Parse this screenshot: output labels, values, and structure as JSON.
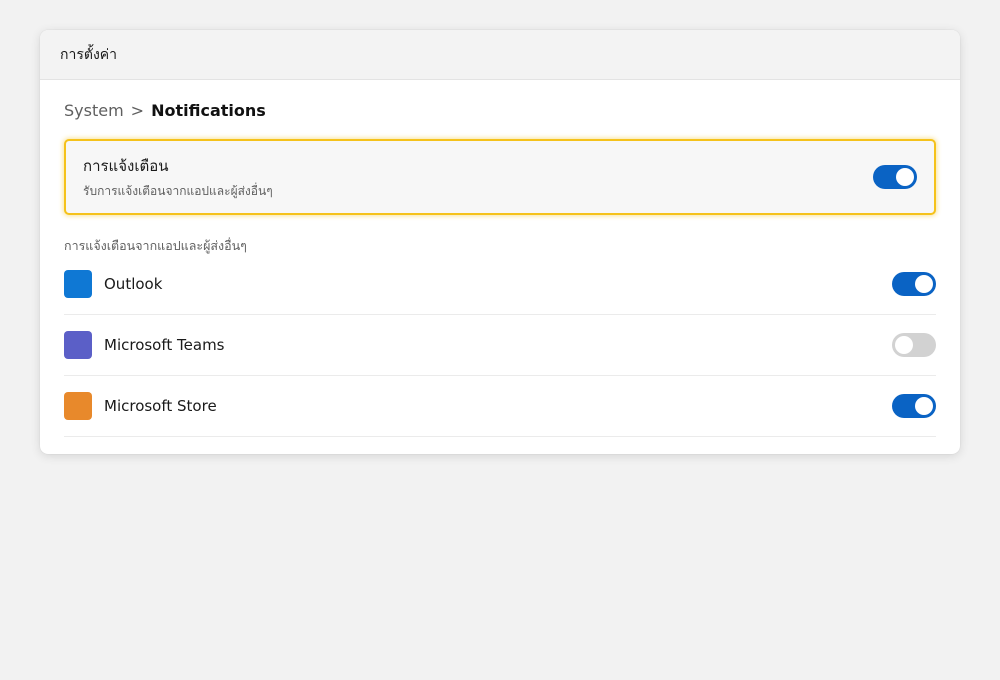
{
  "window": {
    "title": "การตั้งค่า"
  },
  "breadcrumb": {
    "parent": "System",
    "separator": ">",
    "current": "Notifications"
  },
  "master": {
    "title": "การแจ้งเตือน",
    "subtitle": "รับการแจ้งเตือนจากแอปและผู้ส่งอื่นๆ",
    "enabled": true,
    "highlight_color": "#f5c21b"
  },
  "section": {
    "label": "การแจ้งเตือนจากแอปและผู้ส่งอื่นๆ"
  },
  "apps": [
    {
      "name": "Outlook",
      "icon_color": "#0f78d4",
      "enabled": true
    },
    {
      "name": "Microsoft Teams",
      "icon_color": "#5b5fc7",
      "enabled": false
    },
    {
      "name": "Microsoft Store",
      "icon_color": "#e8892b",
      "enabled": true
    }
  ],
  "colors": {
    "toggle_on": "#0a63c4",
    "toggle_off": "#d2d2d2"
  }
}
